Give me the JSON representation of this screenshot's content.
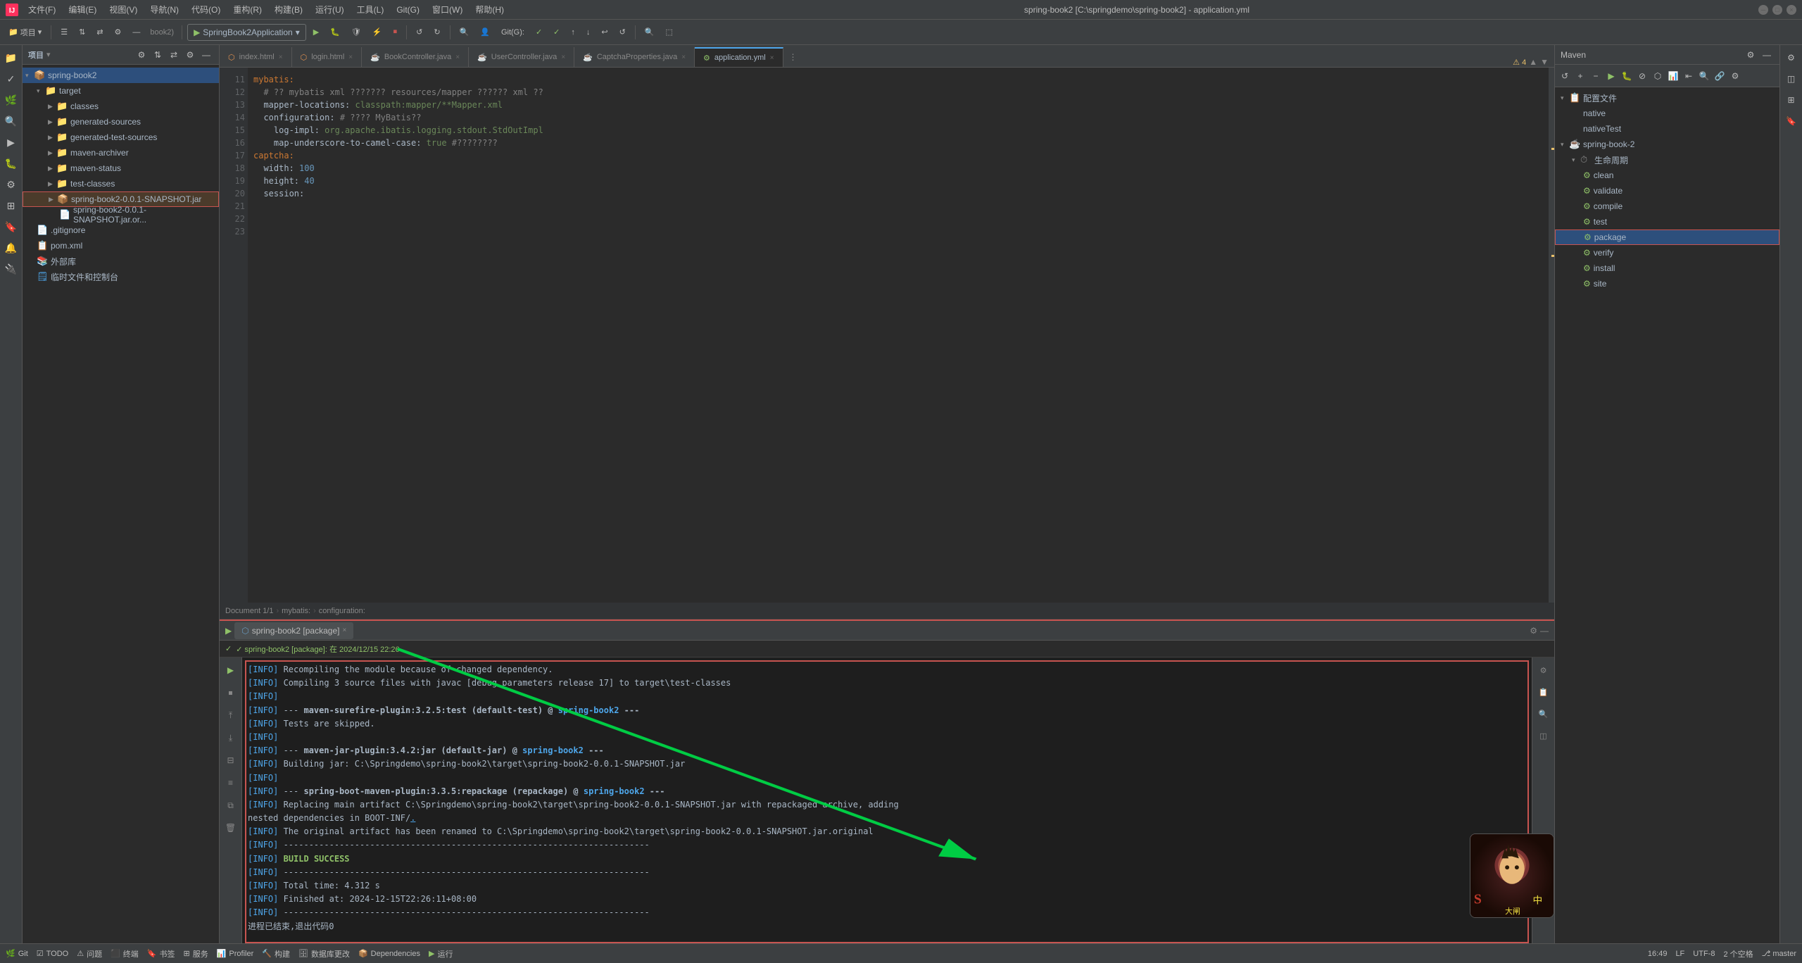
{
  "app": {
    "title": "spring-book2 [C:\\springdemo\\spring-book2] - application.yml",
    "project_name": "spring-book2"
  },
  "menu": {
    "items": [
      "文件(F)",
      "编辑(E)",
      "视图(V)",
      "导航(N)",
      "代码(O)",
      "重构(R)",
      "构建(B)",
      "运行(U)",
      "工具(L)",
      "Git(G)",
      "窗口(W)",
      "帮助(H)"
    ]
  },
  "toolbar": {
    "run_config": "SpringBook2Application",
    "buttons": [
      "▶",
      "⏸",
      "⏹",
      "⚙",
      "↺",
      "→",
      "◀"
    ]
  },
  "tabs": [
    {
      "label": "项目",
      "active": false
    },
    {
      "label": "index.html",
      "active": false
    },
    {
      "label": "login.html",
      "active": false
    },
    {
      "label": "BookController.java",
      "active": false
    },
    {
      "label": "UserController.java",
      "active": false
    },
    {
      "label": "CaptchaProperties.java",
      "active": false
    },
    {
      "label": "application.yml",
      "active": true
    }
  ],
  "breadcrumb": {
    "parts": [
      "Document 1/1",
      "mybatis:",
      "configuration:"
    ]
  },
  "editor": {
    "lines": [
      {
        "num": 11,
        "content": "mybatis:"
      },
      {
        "num": 12,
        "content": "  # ?? mybatis xml ??????? resources/mapper ?????? xml ??"
      },
      {
        "num": 13,
        "content": "  mapper-locations: classpath:mapper/**Mapper.xml"
      },
      {
        "num": 14,
        "content": "  configuration: # ???? MyBatis??"
      },
      {
        "num": 15,
        "content": "    log-impl: org.apache.ibatis.logging.stdout.StdOutImpl"
      },
      {
        "num": 16,
        "content": "    map-underscore-to-camel-case: true #????????"
      },
      {
        "num": 17,
        "content": ""
      },
      {
        "num": 18,
        "content": ""
      },
      {
        "num": 19,
        "content": ""
      },
      {
        "num": 20,
        "content": "captcha:"
      },
      {
        "num": 21,
        "content": "  width: 100"
      },
      {
        "num": 22,
        "content": "  height: 40"
      },
      {
        "num": 23,
        "content": "  session:"
      }
    ]
  },
  "file_tree": {
    "root": "spring-book2",
    "items": [
      {
        "indent": 0,
        "type": "folder",
        "name": "target",
        "expanded": true
      },
      {
        "indent": 1,
        "type": "folder",
        "name": "classes",
        "expanded": false
      },
      {
        "indent": 1,
        "type": "folder",
        "name": "generated-sources",
        "expanded": false
      },
      {
        "indent": 1,
        "type": "folder",
        "name": "generated-test-sources",
        "expanded": false
      },
      {
        "indent": 1,
        "type": "folder",
        "name": "maven-archiver",
        "expanded": false
      },
      {
        "indent": 1,
        "type": "folder",
        "name": "maven-status",
        "expanded": false
      },
      {
        "indent": 1,
        "type": "folder",
        "name": "test-classes",
        "expanded": false
      },
      {
        "indent": 1,
        "type": "jar",
        "name": "spring-book2-0.0.1-SNAPSHOT.jar",
        "highlighted": true
      },
      {
        "indent": 2,
        "type": "jar",
        "name": "spring-book2-0.0.1-SNAPSHOT.jar.or..."
      },
      {
        "indent": 0,
        "type": "file",
        "name": ".gitignore"
      },
      {
        "indent": 0,
        "type": "xml",
        "name": "pom.xml"
      },
      {
        "indent": 0,
        "type": "folder",
        "name": "外部库"
      },
      {
        "indent": 0,
        "type": "folder",
        "name": "临时文件和控制台"
      }
    ]
  },
  "maven": {
    "title": "Maven",
    "sections": [
      {
        "indent": 0,
        "type": "folder",
        "name": "配置文件",
        "expanded": true
      },
      {
        "indent": 1,
        "type": "item",
        "name": "native"
      },
      {
        "indent": 1,
        "type": "item",
        "name": "nativeTest"
      },
      {
        "indent": 0,
        "type": "folder",
        "name": "spring-book-2",
        "expanded": true
      },
      {
        "indent": 1,
        "type": "folder",
        "name": "生命周期",
        "expanded": true
      },
      {
        "indent": 2,
        "type": "gear",
        "name": "clean"
      },
      {
        "indent": 2,
        "type": "gear",
        "name": "validate"
      },
      {
        "indent": 2,
        "type": "gear",
        "name": "compile"
      },
      {
        "indent": 2,
        "type": "gear",
        "name": "test"
      },
      {
        "indent": 2,
        "type": "gear",
        "name": "package",
        "selected": true
      },
      {
        "indent": 2,
        "type": "gear",
        "name": "verify"
      },
      {
        "indent": 2,
        "type": "gear",
        "name": "install"
      },
      {
        "indent": 2,
        "type": "gear",
        "name": "site"
      }
    ]
  },
  "run_panel": {
    "tab_label": "spring-book2 [package]",
    "close_label": "×",
    "status_text": "✓ spring-book2 [package]: 在 2024/12/15 22:26",
    "log_lines": [
      {
        "type": "info",
        "text": "[INFO] Recompiling the module because of changed dependency."
      },
      {
        "type": "info",
        "text": "[INFO] Compiling 3 source files with javac [debug parameters release 17] to target\\test-classes"
      },
      {
        "type": "info",
        "text": "[INFO]"
      },
      {
        "type": "info",
        "text": "[INFO] --- maven-surefire-plugin:3.2.5:test (default-test) @ spring-book2 ---"
      },
      {
        "type": "info",
        "text": "[INFO] Tests are skipped."
      },
      {
        "type": "info",
        "text": "[INFO]"
      },
      {
        "type": "info",
        "text": "[INFO] --- maven-jar-plugin:3.4.2:jar (default-jar) @ spring-book2 ---"
      },
      {
        "type": "info",
        "text": "[INFO] Building jar: C:\\Springdemo\\spring-book2\\target\\spring-book2-0.0.1-SNAPSHOT.jar"
      },
      {
        "type": "info",
        "text": "[INFO]"
      },
      {
        "type": "info",
        "text": "[INFO] --- spring-boot-maven-plugin:3.3.5:repackage (repackage) @ spring-book2 ---"
      },
      {
        "type": "info",
        "text": "[INFO] Replacing main artifact C:\\Springdemo\\spring-book2\\target\\spring-book2-0.0.1-SNAPSHOT.jar with repackaged archive, adding"
      },
      {
        "type": "info",
        "text": " nested dependencies in BOOT-INF/."
      },
      {
        "type": "info",
        "text": "[INFO] The original artifact has been renamed to C:\\Springdemo\\spring-book2\\target\\spring-book2-0.0.1-SNAPSHOT.jar.original"
      },
      {
        "type": "info",
        "text": "[INFO] ------------------------------------------------------------------------"
      },
      {
        "type": "success",
        "text": "[INFO] BUILD SUCCESS"
      },
      {
        "type": "info",
        "text": "[INFO] ------------------------------------------------------------------------"
      },
      {
        "type": "info",
        "text": "[INFO] Total time:  4.312 s"
      },
      {
        "type": "info",
        "text": "[INFO] Finished at: 2024-12-15T22:26:11+08:00"
      },
      {
        "type": "info",
        "text": "[INFO] ------------------------------------------------------------------------"
      },
      {
        "type": "normal",
        "text": ""
      },
      {
        "type": "normal",
        "text": "进程已结束,退出代码0"
      }
    ]
  },
  "status_bar": {
    "git": "Git",
    "todo": "TODO",
    "problems": "问题",
    "terminal": "终端",
    "bookmarks": "书签",
    "services": "服务",
    "profiler": "Profiler",
    "build": "构建",
    "database": "数据库更改",
    "dependencies": "Dependencies",
    "run": "运行",
    "right": {
      "time": "16:49",
      "encoding": "UTF-8",
      "line_col": "LF",
      "spaces": "2 个空格",
      "branch": "master"
    }
  },
  "colors": {
    "accent": "#4ea6ea",
    "success": "#8fc168",
    "error": "#c75450",
    "warning": "#e8bf6a",
    "bg_dark": "#1e1e1e",
    "bg_mid": "#2b2b2b",
    "bg_light": "#3c3f41",
    "border": "#555555"
  }
}
